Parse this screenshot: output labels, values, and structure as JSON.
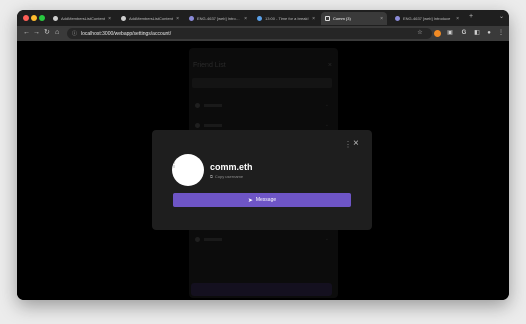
{
  "browser": {
    "tabs": [
      {
        "label": "AddMembersListContent",
        "icon": "github-icon",
        "active": false
      },
      {
        "label": "AddMembersListContent",
        "icon": "github-icon",
        "active": false
      },
      {
        "label": "ENG-4637 [web] Introduce",
        "icon": "linear-icon",
        "active": false
      },
      {
        "label": "13:00 - Time for a break!",
        "icon": "timer-icon",
        "active": false
      },
      {
        "label": "Comm (3)",
        "icon": "comm-icon",
        "active": true
      },
      {
        "label": "ENG-4637 [web] Introduce",
        "icon": "linear-icon",
        "active": false
      }
    ],
    "new_tab": "+",
    "url": "localhost:3000/webapp/settings/account/",
    "accent": "#6e55c6"
  },
  "background_panel": {
    "title": "Friend List"
  },
  "modal": {
    "username": "comm.eth",
    "copy_label": "Copy username",
    "message_label": "Message"
  }
}
